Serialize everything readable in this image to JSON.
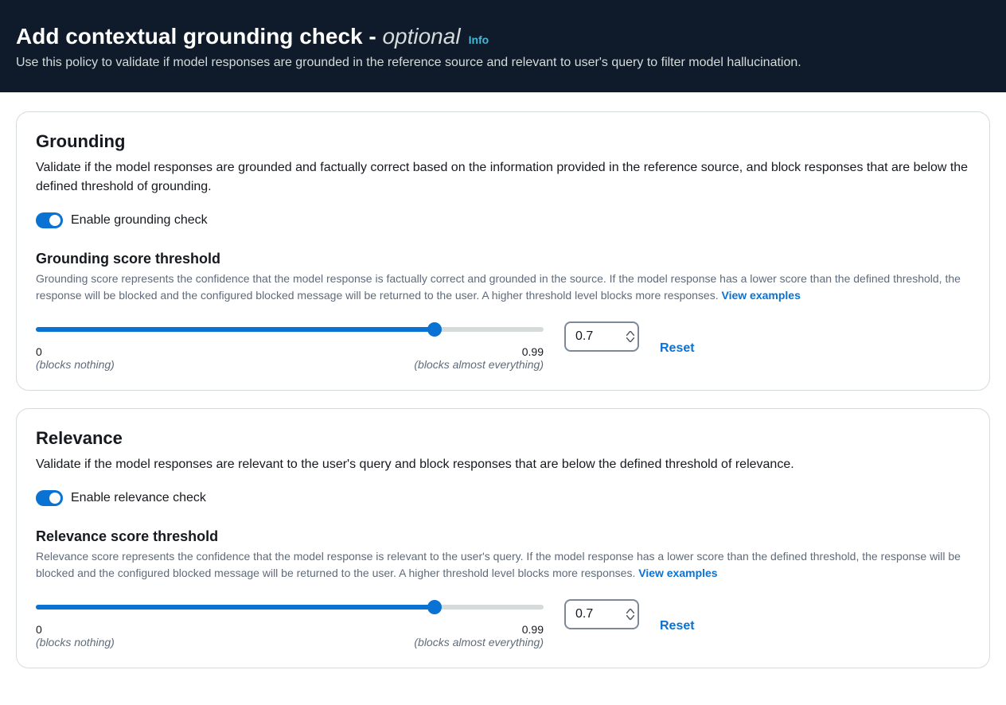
{
  "header": {
    "title_main": "Add contextual grounding check - ",
    "title_optional": "optional",
    "info_label": "Info",
    "description": "Use this policy to validate if model responses are grounded in the reference source and relevant to user's query to filter model hallucination."
  },
  "grounding": {
    "title": "Grounding",
    "description": "Validate if the model responses are grounded and factually correct based on the information provided in the reference source, and block responses that are below the defined threshold of grounding.",
    "toggle_label": "Enable grounding check",
    "toggle_on": true,
    "threshold_title": "Grounding score threshold",
    "threshold_desc": "Grounding score represents the confidence that the model response is factually correct and grounded in the source. If the model response has a lower score than the defined threshold, the response will be blocked and the configured blocked message will be returned to the user. A higher threshold level blocks more responses. ",
    "view_examples_label": "View examples",
    "slider": {
      "min": 0,
      "max": 0.99,
      "value": 0.7,
      "min_label": "0",
      "max_label": "0.99",
      "min_hint": "(blocks nothing)",
      "max_hint": "(blocks almost everything)",
      "input_value": "0.7",
      "reset_label": "Reset"
    }
  },
  "relevance": {
    "title": "Relevance",
    "description": "Validate if the model responses are relevant to the user's query and block responses that are below the defined threshold of relevance.",
    "toggle_label": "Enable relevance check",
    "toggle_on": true,
    "threshold_title": "Relevance score threshold",
    "threshold_desc": "Relevance score represents the confidence that the model response is relevant to the user's query. If the model response has a lower score than the defined threshold, the response will be blocked and the configured blocked message will be returned to the user. A higher threshold level blocks more responses. ",
    "view_examples_label": "View examples",
    "slider": {
      "min": 0,
      "max": 0.99,
      "value": 0.7,
      "min_label": "0",
      "max_label": "0.99",
      "min_hint": "(blocks nothing)",
      "max_hint": "(blocks almost everything)",
      "input_value": "0.7",
      "reset_label": "Reset"
    }
  }
}
